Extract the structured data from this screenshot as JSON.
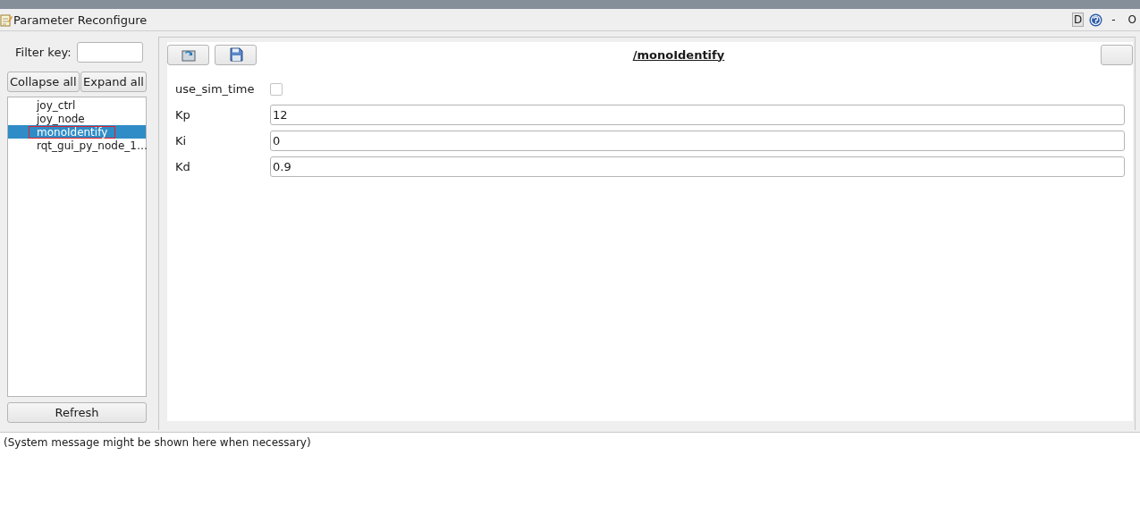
{
  "window": {
    "title": "Parameter Reconfigure",
    "controls": [
      {
        "kind": "button",
        "label": "D"
      },
      {
        "kind": "help"
      },
      {
        "kind": "text",
        "label": "-"
      },
      {
        "kind": "text",
        "label": "O"
      }
    ]
  },
  "sidebar": {
    "filter_label": "Filter key:",
    "collapse_button": "Collapse all",
    "expand_button": "Expand all",
    "nodes": [
      {
        "label": "joy_ctrl",
        "selected": false
      },
      {
        "label": "joy_node",
        "selected": false
      },
      {
        "label": "monoIdentify",
        "selected": true
      },
      {
        "label": "rqt_gui_py_node_1…",
        "selected": false
      }
    ],
    "refresh_button": "Refresh"
  },
  "editor": {
    "title": "/monoIdentify",
    "params": [
      {
        "kind": "bool",
        "name": "use_sim_time",
        "checked": false
      },
      {
        "kind": "text",
        "name": "Kp",
        "value": "12"
      },
      {
        "kind": "text",
        "name": "Ki",
        "value": "0"
      },
      {
        "kind": "text",
        "name": "Kd",
        "value": "0.9"
      }
    ]
  },
  "status_bar": "(System message might be shown here when necessary)"
}
